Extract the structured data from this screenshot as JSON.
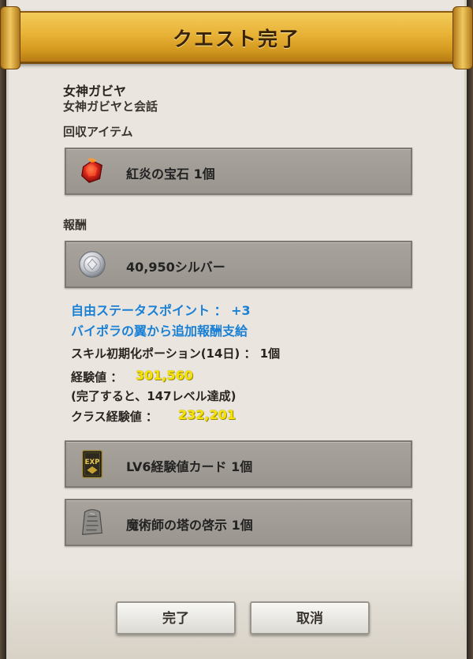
{
  "dialog": {
    "title": "クエスト完了",
    "quest_name": "女神ガビヤ",
    "quest_sub": "女神ガビヤと会話"
  },
  "collect": {
    "section_label": "回収アイテム",
    "item": {
      "icon": "red-gem-icon",
      "label": "紅炎の宝石  1個"
    }
  },
  "reward": {
    "section_label": "報酬",
    "silver": {
      "icon": "silver-coin-icon",
      "label": "40,950シルバー"
    },
    "stat_points": "自由ステータスポイント ： +3",
    "bonus_title": "バイポラの翼から追加報酬支給",
    "bonus_item": "スキル初期化ポーション(14日) ： 1個",
    "exp_label": "経験値 ：",
    "exp_value": "301,560",
    "exp_note": "(完了すると、147レベル達成)",
    "class_exp_label": "クラス経験値 ：",
    "class_exp_value": "232,201",
    "items": [
      {
        "icon": "exp-card-icon",
        "label": "LV6経験値カード  1個"
      },
      {
        "icon": "stone-tablet-icon",
        "label": "魔術師の塔の啓示  1個"
      }
    ]
  },
  "buttons": {
    "complete": "完了",
    "cancel": "取消"
  },
  "colors": {
    "banner": "#e8b236",
    "highlight_blue": "#1a80d6",
    "highlight_yellow": "#f7e400",
    "panel": "#eae6df",
    "item_box": "#a29d96"
  }
}
